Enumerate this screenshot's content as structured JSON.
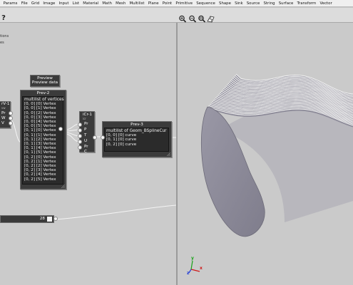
{
  "menubar": {
    "items": [
      "Params",
      "File",
      "Grid",
      "Image",
      "Input",
      "List",
      "Material",
      "Math",
      "Mesh",
      "Multilist",
      "Plane",
      "Point",
      "Primitive",
      "Sequence",
      "Shape",
      "Sink",
      "Source",
      "String",
      "Surface",
      "Transform",
      "Vector"
    ]
  },
  "toolbar": {
    "help_label": "?"
  },
  "canvas": {
    "faint_text_1": "tions",
    "faint_text_2": "es"
  },
  "preview_node": {
    "title": "Preview",
    "subtitle": "Preview data"
  },
  "node_v1": {
    "title": "rV-1",
    "subtitle": "vw",
    "ports": [
      "Pr",
      "W",
      "V"
    ]
  },
  "prev2": {
    "title": "Prev-2",
    "header": "multilist of vertices",
    "rows": [
      "[0, 0] [0]  Vertex",
      "[0, 0] [1]  Vertex",
      "[0, 0] [2]  Vertex",
      "[0, 0] [3]  Vertex",
      "[0, 0] [4]  Vertex",
      "[0, 0] [5]  Vertex",
      "[0, 1] [0]  Vertex",
      "[0, 1] [1]  Vertex",
      "[0, 1] [2]  Vertex",
      "[0, 1] [3]  Vertex",
      "[0, 1] [4]  Vertex",
      "[0, 1] [5]  Vertex",
      "[0, 2] [0]  Vertex",
      "[0, 2] [1]  Vertex",
      "[0, 2] [2]  Vertex",
      "[0, 2] [3]  Vertex",
      "[0, 2] [4]  Vertex",
      "[0, 2] [5]  Vertex"
    ]
  },
  "cr1": {
    "title": "iCr-1",
    "subtitle": "icr",
    "ports": [
      "Pr",
      "P",
      "T",
      "U",
      "Pr",
      "C"
    ]
  },
  "prev3": {
    "title": "Prev-3",
    "header": "multilist of Geom_BSplineCur",
    "rows": [
      "[0, 0] [0]  curve",
      "[0, 1] [0]  curve",
      "[0, 2] [0]  curve"
    ]
  },
  "slider": {
    "value": "28"
  },
  "gizmo": {
    "x": "x",
    "y": "y",
    "z": "z"
  },
  "colors": {
    "node_bg": "#3b3b3b",
    "panel_bg": "#2b2b2b",
    "canvas_bg": "#cbcbcb",
    "surface_fill": "#8e8c9a"
  }
}
